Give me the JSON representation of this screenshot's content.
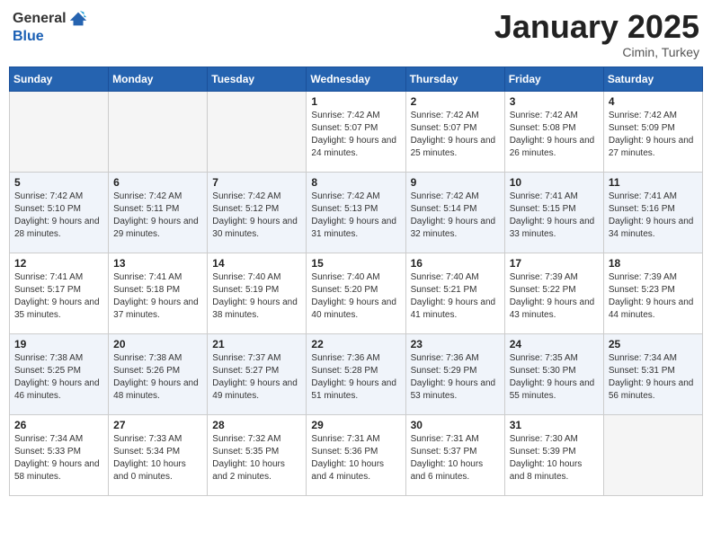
{
  "header": {
    "logo_general": "General",
    "logo_blue": "Blue",
    "month": "January 2025",
    "location": "Cimin, Turkey"
  },
  "weekdays": [
    "Sunday",
    "Monday",
    "Tuesday",
    "Wednesday",
    "Thursday",
    "Friday",
    "Saturday"
  ],
  "weeks": [
    [
      {
        "day": "",
        "info": ""
      },
      {
        "day": "",
        "info": ""
      },
      {
        "day": "",
        "info": ""
      },
      {
        "day": "1",
        "info": "Sunrise: 7:42 AM\nSunset: 5:07 PM\nDaylight: 9 hours\nand 24 minutes."
      },
      {
        "day": "2",
        "info": "Sunrise: 7:42 AM\nSunset: 5:07 PM\nDaylight: 9 hours\nand 25 minutes."
      },
      {
        "day": "3",
        "info": "Sunrise: 7:42 AM\nSunset: 5:08 PM\nDaylight: 9 hours\nand 26 minutes."
      },
      {
        "day": "4",
        "info": "Sunrise: 7:42 AM\nSunset: 5:09 PM\nDaylight: 9 hours\nand 27 minutes."
      }
    ],
    [
      {
        "day": "5",
        "info": "Sunrise: 7:42 AM\nSunset: 5:10 PM\nDaylight: 9 hours\nand 28 minutes."
      },
      {
        "day": "6",
        "info": "Sunrise: 7:42 AM\nSunset: 5:11 PM\nDaylight: 9 hours\nand 29 minutes."
      },
      {
        "day": "7",
        "info": "Sunrise: 7:42 AM\nSunset: 5:12 PM\nDaylight: 9 hours\nand 30 minutes."
      },
      {
        "day": "8",
        "info": "Sunrise: 7:42 AM\nSunset: 5:13 PM\nDaylight: 9 hours\nand 31 minutes."
      },
      {
        "day": "9",
        "info": "Sunrise: 7:42 AM\nSunset: 5:14 PM\nDaylight: 9 hours\nand 32 minutes."
      },
      {
        "day": "10",
        "info": "Sunrise: 7:41 AM\nSunset: 5:15 PM\nDaylight: 9 hours\nand 33 minutes."
      },
      {
        "day": "11",
        "info": "Sunrise: 7:41 AM\nSunset: 5:16 PM\nDaylight: 9 hours\nand 34 minutes."
      }
    ],
    [
      {
        "day": "12",
        "info": "Sunrise: 7:41 AM\nSunset: 5:17 PM\nDaylight: 9 hours\nand 35 minutes."
      },
      {
        "day": "13",
        "info": "Sunrise: 7:41 AM\nSunset: 5:18 PM\nDaylight: 9 hours\nand 37 minutes."
      },
      {
        "day": "14",
        "info": "Sunrise: 7:40 AM\nSunset: 5:19 PM\nDaylight: 9 hours\nand 38 minutes."
      },
      {
        "day": "15",
        "info": "Sunrise: 7:40 AM\nSunset: 5:20 PM\nDaylight: 9 hours\nand 40 minutes."
      },
      {
        "day": "16",
        "info": "Sunrise: 7:40 AM\nSunset: 5:21 PM\nDaylight: 9 hours\nand 41 minutes."
      },
      {
        "day": "17",
        "info": "Sunrise: 7:39 AM\nSunset: 5:22 PM\nDaylight: 9 hours\nand 43 minutes."
      },
      {
        "day": "18",
        "info": "Sunrise: 7:39 AM\nSunset: 5:23 PM\nDaylight: 9 hours\nand 44 minutes."
      }
    ],
    [
      {
        "day": "19",
        "info": "Sunrise: 7:38 AM\nSunset: 5:25 PM\nDaylight: 9 hours\nand 46 minutes."
      },
      {
        "day": "20",
        "info": "Sunrise: 7:38 AM\nSunset: 5:26 PM\nDaylight: 9 hours\nand 48 minutes."
      },
      {
        "day": "21",
        "info": "Sunrise: 7:37 AM\nSunset: 5:27 PM\nDaylight: 9 hours\nand 49 minutes."
      },
      {
        "day": "22",
        "info": "Sunrise: 7:36 AM\nSunset: 5:28 PM\nDaylight: 9 hours\nand 51 minutes."
      },
      {
        "day": "23",
        "info": "Sunrise: 7:36 AM\nSunset: 5:29 PM\nDaylight: 9 hours\nand 53 minutes."
      },
      {
        "day": "24",
        "info": "Sunrise: 7:35 AM\nSunset: 5:30 PM\nDaylight: 9 hours\nand 55 minutes."
      },
      {
        "day": "25",
        "info": "Sunrise: 7:34 AM\nSunset: 5:31 PM\nDaylight: 9 hours\nand 56 minutes."
      }
    ],
    [
      {
        "day": "26",
        "info": "Sunrise: 7:34 AM\nSunset: 5:33 PM\nDaylight: 9 hours\nand 58 minutes."
      },
      {
        "day": "27",
        "info": "Sunrise: 7:33 AM\nSunset: 5:34 PM\nDaylight: 10 hours\nand 0 minutes."
      },
      {
        "day": "28",
        "info": "Sunrise: 7:32 AM\nSunset: 5:35 PM\nDaylight: 10 hours\nand 2 minutes."
      },
      {
        "day": "29",
        "info": "Sunrise: 7:31 AM\nSunset: 5:36 PM\nDaylight: 10 hours\nand 4 minutes."
      },
      {
        "day": "30",
        "info": "Sunrise: 7:31 AM\nSunset: 5:37 PM\nDaylight: 10 hours\nand 6 minutes."
      },
      {
        "day": "31",
        "info": "Sunrise: 7:30 AM\nSunset: 5:39 PM\nDaylight: 10 hours\nand 8 minutes."
      },
      {
        "day": "",
        "info": ""
      }
    ]
  ]
}
